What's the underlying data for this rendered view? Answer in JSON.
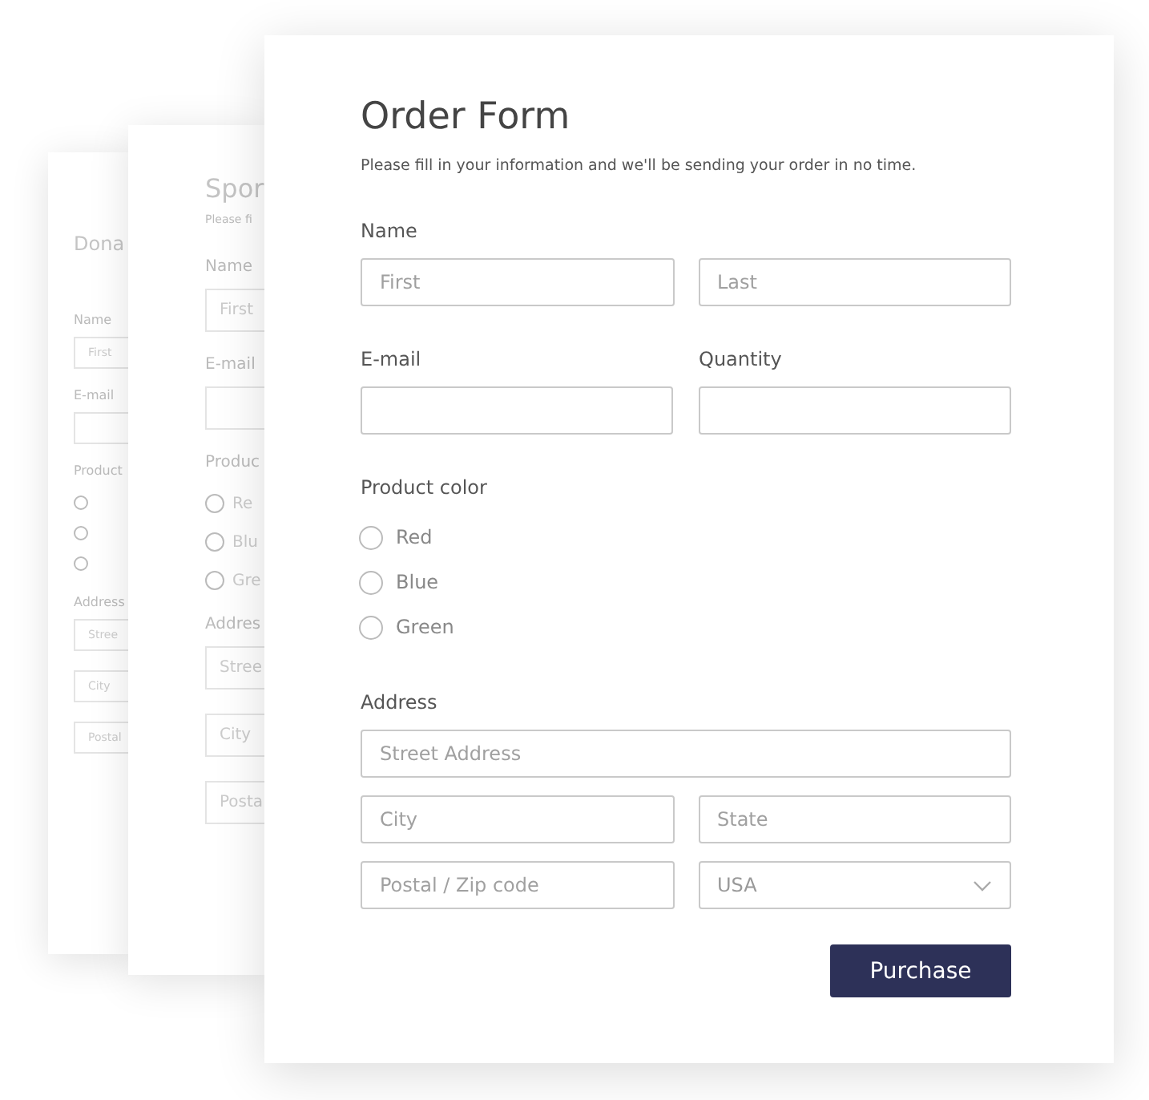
{
  "back_forms": [
    {
      "title": "Dona",
      "items": [
        {
          "kind": "label",
          "text": "Name"
        },
        {
          "kind": "field",
          "placeholder": "First"
        },
        {
          "kind": "label",
          "text": "E-mail"
        },
        {
          "kind": "field"
        },
        {
          "kind": "label",
          "text": "Product"
        },
        {
          "kind": "radio",
          "selected": false
        },
        {
          "kind": "radio",
          "selected": false
        },
        {
          "kind": "radio",
          "selected": false
        },
        {
          "kind": "label",
          "text": "Address"
        },
        {
          "kind": "field",
          "placeholder": "Stree"
        },
        {
          "kind": "field",
          "placeholder": "City"
        },
        {
          "kind": "field",
          "placeholder": "Postal"
        }
      ]
    },
    {
      "title": "Spor",
      "subtitle": "Please fi",
      "items": [
        {
          "kind": "label",
          "text": "Name"
        },
        {
          "kind": "field",
          "placeholder": "First"
        },
        {
          "kind": "label",
          "text": "E-mail"
        },
        {
          "kind": "field"
        },
        {
          "kind": "label",
          "text": "Produc"
        },
        {
          "kind": "radio",
          "text": "Re",
          "selected": false
        },
        {
          "kind": "radio",
          "text": "Blu",
          "selected": false
        },
        {
          "kind": "radio",
          "text": "Gre",
          "selected": false
        },
        {
          "kind": "label",
          "text": "Addres"
        },
        {
          "kind": "field",
          "placeholder": "Stree"
        },
        {
          "kind": "field",
          "placeholder": "City"
        },
        {
          "kind": "field",
          "placeholder": "Posta"
        }
      ]
    }
  ],
  "form": {
    "title": "Order Form",
    "subtitle": "Please fill in your information and we'll be sending your order in no time.",
    "sections": [
      {
        "kind": "fields",
        "label": "Name",
        "rows": [
          [
            {
              "kind": "input",
              "placeholder": "First"
            },
            {
              "kind": "input",
              "placeholder": "Last"
            }
          ]
        ]
      },
      {
        "kind": "columns",
        "columns": [
          {
            "label": "E-mail"
          },
          {
            "label": "Quantity"
          }
        ]
      },
      {
        "kind": "radios",
        "label": "Product color",
        "options": [
          {
            "label": "Red",
            "selected": false
          },
          {
            "label": "Blue",
            "selected": false
          },
          {
            "label": "Green",
            "selected": false
          }
        ]
      },
      {
        "kind": "fields",
        "label": "Address",
        "rows": [
          [
            {
              "kind": "input",
              "placeholder": "Street Address"
            }
          ],
          [
            {
              "kind": "input",
              "placeholder": "City"
            },
            {
              "kind": "input",
              "placeholder": "State"
            }
          ],
          [
            {
              "kind": "input",
              "placeholder": "Postal / Zip code"
            },
            {
              "kind": "select",
              "value": "USA"
            }
          ]
        ]
      }
    ],
    "button": "Purchase"
  }
}
